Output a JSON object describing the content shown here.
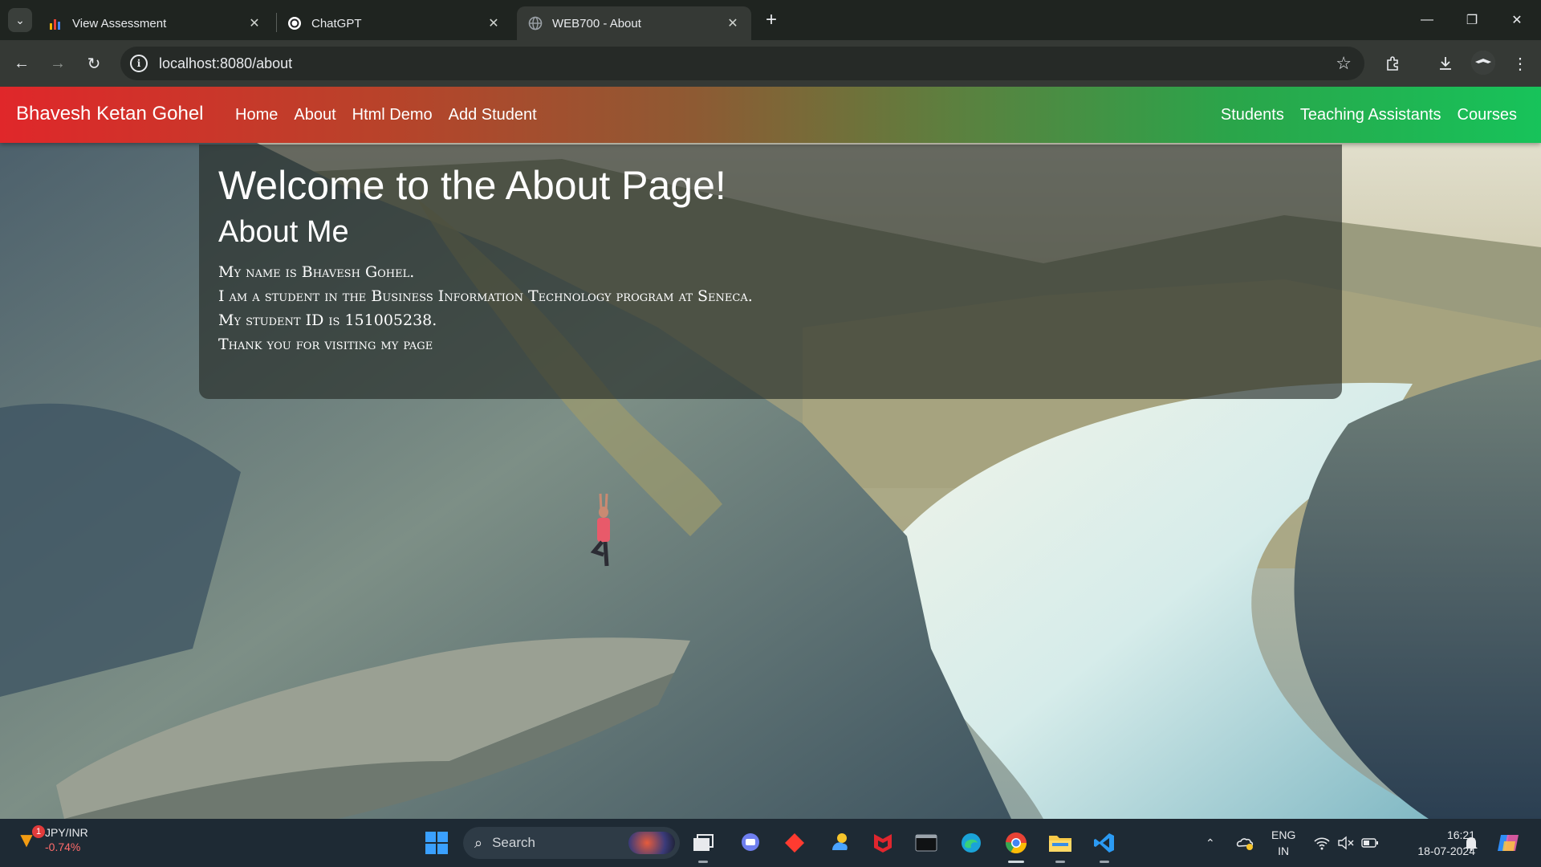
{
  "browser": {
    "tabs": [
      {
        "title": "View Assessment",
        "icon": "bar-chart-icon"
      },
      {
        "title": "ChatGPT",
        "icon": "chatgpt-icon"
      },
      {
        "title": "WEB700 - About",
        "icon": "globe-icon",
        "active": true
      }
    ],
    "url": "localhost:8080/about"
  },
  "site": {
    "brand": "Bhavesh Ketan Gohel",
    "nav_left": [
      "Home",
      "About",
      "Html Demo",
      "Add Student"
    ],
    "nav_right": [
      "Students",
      "Teaching Assistants",
      "Courses"
    ],
    "nav_gradient": [
      "#e0272a",
      "#17c35a"
    ]
  },
  "about": {
    "heading": "Welcome to the About Page!",
    "subheading": "About Me",
    "lines": [
      "My name is Bhavesh Gohel.",
      "I am a student in the Business Information Technology program at Seneca.",
      "My student ID is 151005238.",
      "Thank you for visiting my page"
    ]
  },
  "taskbar": {
    "widget": {
      "badge": "1",
      "pair": "JPY/INR",
      "change": "-0.74%"
    },
    "search_placeholder": "Search",
    "language": "ENG",
    "region": "IN",
    "time": "16:21",
    "date": "18-07-2024"
  }
}
